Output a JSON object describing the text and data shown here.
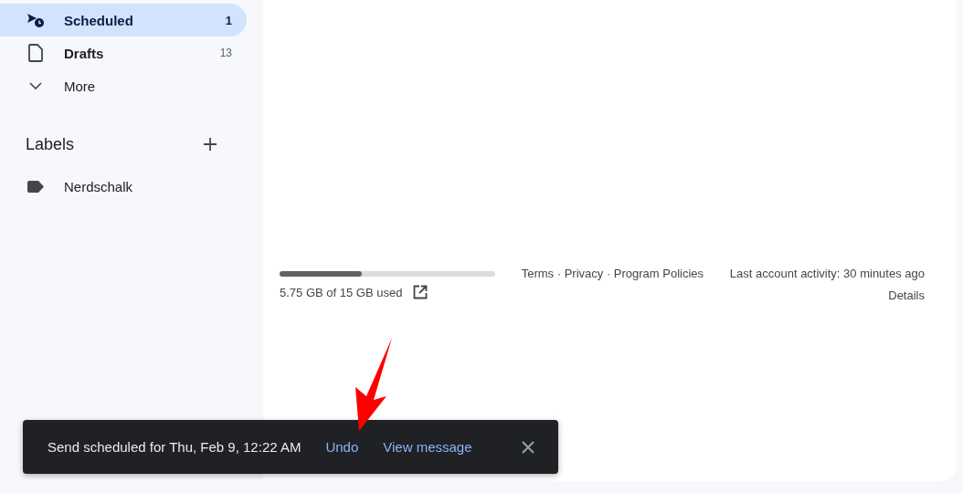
{
  "sidebar": {
    "items": [
      {
        "kind": "scheduled",
        "label": "Scheduled",
        "count": "1",
        "selected": true,
        "bold": true
      },
      {
        "kind": "drafts",
        "label": "Drafts",
        "count": "13",
        "selected": false,
        "bold": true
      },
      {
        "kind": "more",
        "label": "More",
        "selected": false,
        "bold": false
      }
    ],
    "labels_header": "Labels",
    "labels": [
      {
        "label": "Nerdschalk"
      }
    ]
  },
  "footer": {
    "storage": {
      "level": 0.38,
      "text": "5.75 GB of 15 GB used"
    },
    "links": "Terms · Privacy · Program Policies",
    "activity": "Last account activity: 30 minutes ago",
    "details": "Details"
  },
  "snackbar": {
    "message": "Send scheduled for Thu, Feb 9, 12:22 AM",
    "actions": [
      "Undo",
      "View message"
    ]
  }
}
